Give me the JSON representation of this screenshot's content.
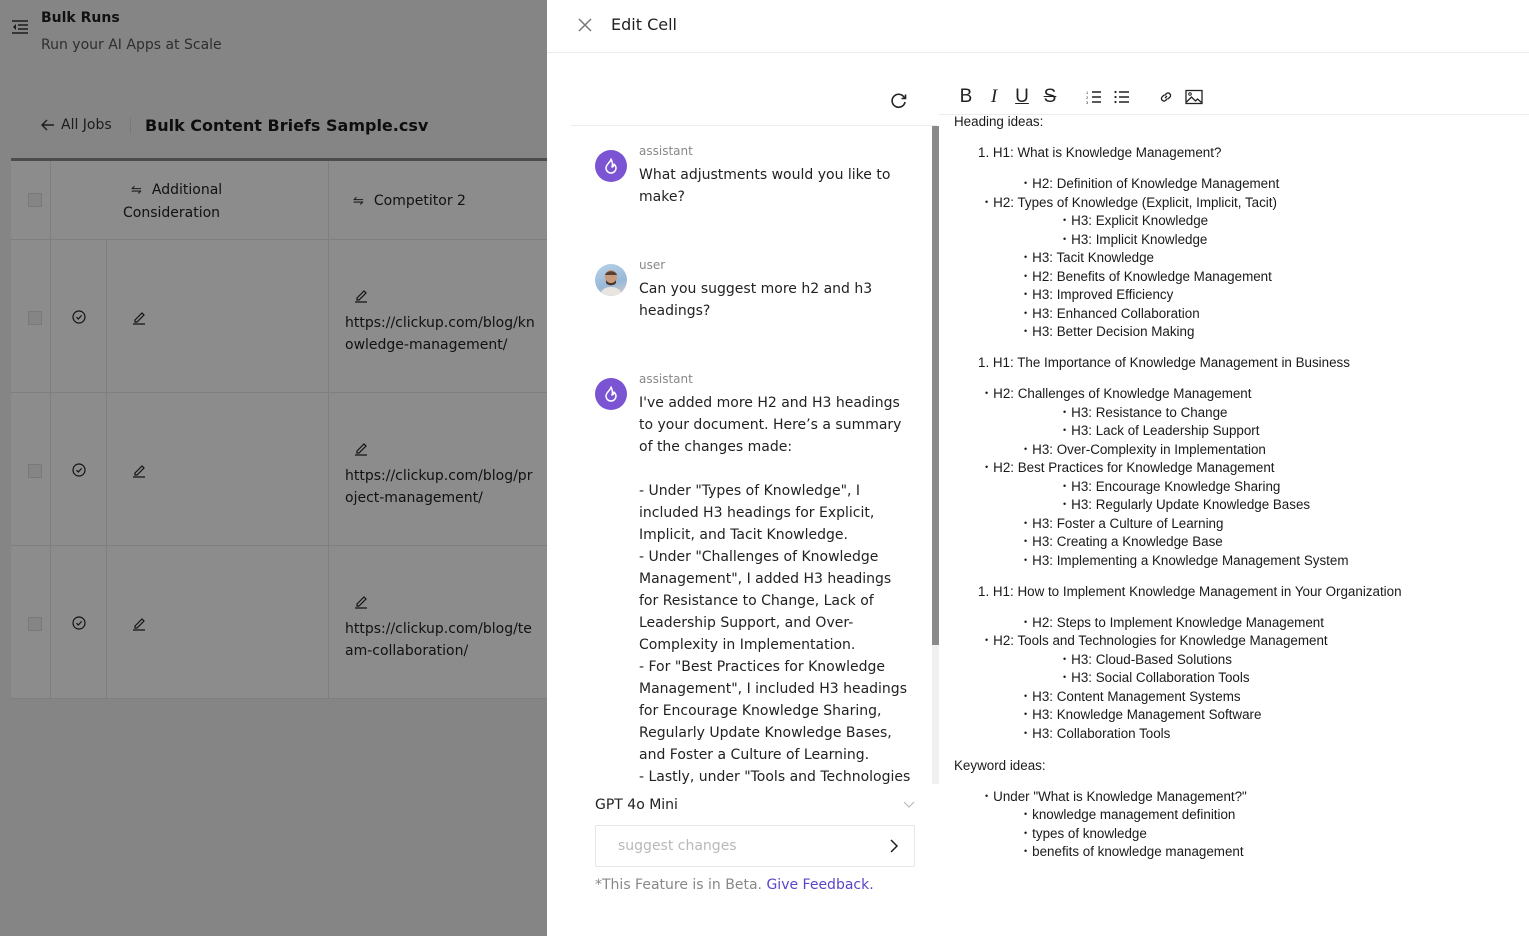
{
  "app": {
    "title": "Bulk Runs",
    "subtitle": "Run your AI Apps at Scale",
    "back_label": "All Jobs",
    "file_name": "Bulk Content Briefs Sample.csv"
  },
  "table": {
    "columns": [
      {
        "label": "Additional Consideration",
        "label_line1": "Additional",
        "label_line2": "Consideration"
      },
      {
        "label": "Competitor 2"
      }
    ],
    "rows": [
      {
        "status": "completed",
        "competitor_2": "https://clickup.com/blog/knowledge-management/"
      },
      {
        "status": "completed",
        "competitor_2": "https://clickup.com/blog/project-management/"
      },
      {
        "status": "completed",
        "competitor_2": "https://clickup.com/blog/team-collaboration/"
      }
    ]
  },
  "drawer": {
    "title": "Edit Cell",
    "chat": {
      "messages": [
        {
          "role": "assistant",
          "text": "What adjustments would you like to make?"
        },
        {
          "role": "user",
          "text": "Can you suggest more h2 and h3 headings?"
        },
        {
          "role": "assistant",
          "text": "I've added more H2 and H3 headings to your document. Here’s a summary of the changes made:\n\n- Under \"Types of Knowledge\", I included H3 headings for Explicit, Implicit, and Tacit Knowledge.\n- Under \"Challenges of Knowledge Management\", I added H3 headings for Resistance to Change, Lack of Leadership Support, and Over-Complexity in Implementation.\n- For \"Best Practices for Knowledge Management\", I included H3 headings for Encourage Knowledge Sharing, Regularly Update Knowledge Bases, and Foster a Culture of Learning.\n- Lastly, under \"Tools and Technologies"
        }
      ],
      "model": "GPT 4o Mini",
      "input_placeholder": "suggest changes",
      "input_value": "",
      "beta_text": "*This Feature is in Beta.",
      "feedback_link": "Give Feedback."
    },
    "toolbar": {
      "bold": "B",
      "italic": "I",
      "underline": "U",
      "strike": "S"
    },
    "editor": {
      "lines": [
        {
          "text": "Heading ideas:",
          "type": "label"
        },
        {
          "text": "1. H1: What is Knowledge Management?",
          "type": "h1"
        },
        {
          "text": "H2: Definition of Knowledge Management",
          "type": "l2"
        },
        {
          "text": "H2: Types of Knowledge (Explicit, Implicit, Tacit)",
          "type": "l1"
        },
        {
          "text": "H3: Explicit Knowledge",
          "type": "l3"
        },
        {
          "text": "H3: Implicit Knowledge",
          "type": "l3"
        },
        {
          "text": "H3: Tacit Knowledge",
          "type": "l2"
        },
        {
          "text": "H2: Benefits of Knowledge Management",
          "type": "l2"
        },
        {
          "text": "H3: Improved Efficiency",
          "type": "l2"
        },
        {
          "text": "H3: Enhanced Collaboration",
          "type": "l2"
        },
        {
          "text": "H3: Better Decision Making",
          "type": "l2"
        },
        {
          "text": "1. H1: The Importance of Knowledge Management in Business",
          "type": "h1"
        },
        {
          "text": "H2: Challenges of Knowledge Management",
          "type": "l1"
        },
        {
          "text": "H3: Resistance to Change",
          "type": "l3"
        },
        {
          "text": "H3: Lack of Leadership Support",
          "type": "l3"
        },
        {
          "text": "H3: Over-Complexity in Implementation",
          "type": "l2"
        },
        {
          "text": "H2: Best Practices for Knowledge Management",
          "type": "l1"
        },
        {
          "text": "H3: Encourage Knowledge Sharing",
          "type": "l3"
        },
        {
          "text": "H3: Regularly Update Knowledge Bases",
          "type": "l3"
        },
        {
          "text": "H3: Foster a Culture of Learning",
          "type": "l2"
        },
        {
          "text": "H3: Creating a Knowledge Base",
          "type": "l2"
        },
        {
          "text": "H3: Implementing a Knowledge Management System",
          "type": "l2"
        },
        {
          "text": "1. H1: How to Implement Knowledge Management in Your Organization",
          "type": "h1"
        },
        {
          "text": "H2: Steps to Implement Knowledge Management",
          "type": "l2"
        },
        {
          "text": "H2: Tools and Technologies for Knowledge Management",
          "type": "l1"
        },
        {
          "text": "H3: Cloud-Based Solutions",
          "type": "l3"
        },
        {
          "text": "H3: Social Collaboration Tools",
          "type": "l3"
        },
        {
          "text": "H3: Content Management Systems",
          "type": "l2"
        },
        {
          "text": "H3: Knowledge Management Software",
          "type": "l2"
        },
        {
          "text": "H3: Collaboration Tools",
          "type": "l2"
        },
        {
          "text": "Keyword ideas:",
          "type": "label"
        },
        {
          "text": "Under \"What is Knowledge Management?\"",
          "type": "l1"
        },
        {
          "text": "knowledge management definition",
          "type": "l2"
        },
        {
          "text": "types of knowledge",
          "type": "l2"
        },
        {
          "text": "benefits of knowledge management",
          "type": "l2"
        }
      ]
    }
  },
  "colors": {
    "accent": "#7b54d3",
    "link": "#5a45c8",
    "overlay": "#888888"
  }
}
